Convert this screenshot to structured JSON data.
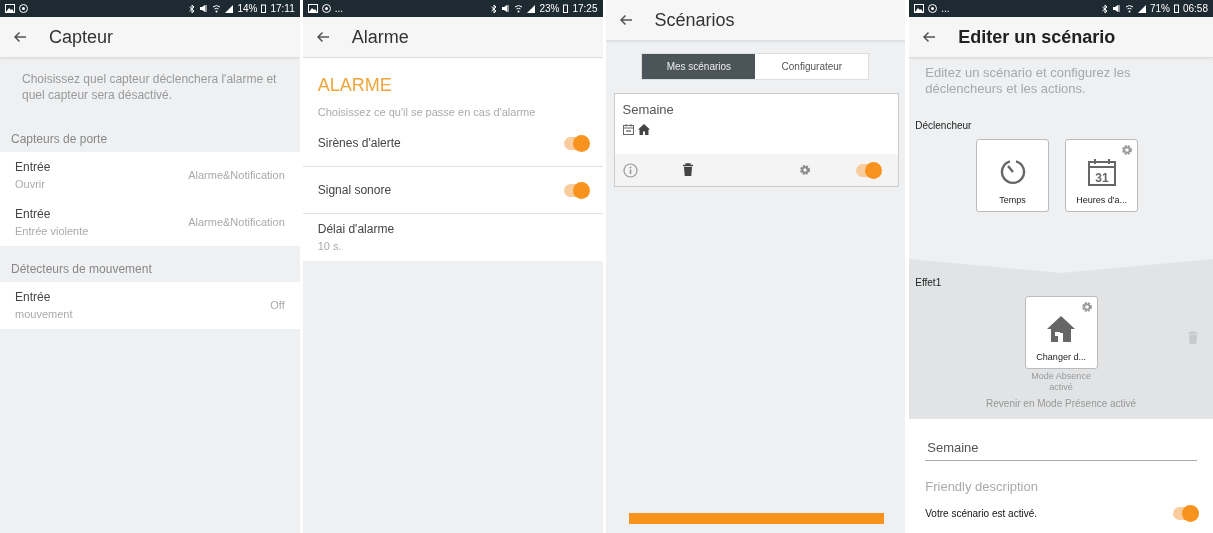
{
  "panels": [
    {
      "kind": "sensors",
      "status_bar": {
        "battery": "14%",
        "time": "17:11"
      },
      "title": "Capteur",
      "intro": "Choisissez quel capteur déclenchera l'alarme et quel capteur sera désactivé.",
      "sections": [
        {
          "heading": "Capteurs de porte",
          "items": [
            {
              "label": "Entrée",
              "sublabel": "Ouvrir",
              "value": "Alarme&Notification"
            },
            {
              "label": "Entrée",
              "sublabel": "Entrée violente",
              "value": "Alarme&Notification"
            }
          ]
        },
        {
          "heading": "Détecteurs de mouvement",
          "items": [
            {
              "label": "Entrée",
              "sublabel": "mouvement",
              "value": "Off"
            }
          ]
        }
      ]
    },
    {
      "kind": "alarm",
      "status_bar": {
        "more": "...",
        "battery": "23%",
        "time": "17:25"
      },
      "title": "Alarme",
      "heading": "ALARME",
      "subtitle": "Choisissez ce qu'il se passe en cas d'alarme",
      "settings": [
        {
          "kind": "toggle",
          "label": "Sirènes d'alerte",
          "on": true
        },
        {
          "kind": "toggle",
          "label": "Signal sonore",
          "on": true
        },
        {
          "kind": "value",
          "label": "Délai d'alarme",
          "value": "10 s."
        }
      ]
    },
    {
      "kind": "scenarios",
      "title": "Scénarios",
      "tabs": [
        {
          "label": "Mes scénarios",
          "selected": true
        },
        {
          "label": "Configurateur",
          "selected": false
        }
      ],
      "scenarios": [
        {
          "name": "Semaine",
          "on": true
        }
      ]
    },
    {
      "kind": "editor",
      "status_bar": {
        "more": "...",
        "battery": "71%",
        "time": "06:58"
      },
      "title": "Editer un scénario",
      "intro": "Editez un scénario et configurez les déclencheurs et les actions.",
      "trigger_label": "Déclencheur",
      "triggers": [
        {
          "kind": "timer",
          "label": "Temps",
          "settings": false
        },
        {
          "kind": "calendar",
          "label": "Heures d'a...",
          "day": "31",
          "settings": true
        }
      ],
      "effect_label": "Effet1",
      "effects": [
        {
          "kind": "home",
          "label": "Changer d...",
          "caption": "Mode Absence activé",
          "settings": true
        }
      ],
      "revert": "Revenir en Mode Présence activé",
      "name_value": "Semaine",
      "description_placeholder": "Friendly description",
      "active_label": "Votre scénario est activé.",
      "active": true
    }
  ]
}
